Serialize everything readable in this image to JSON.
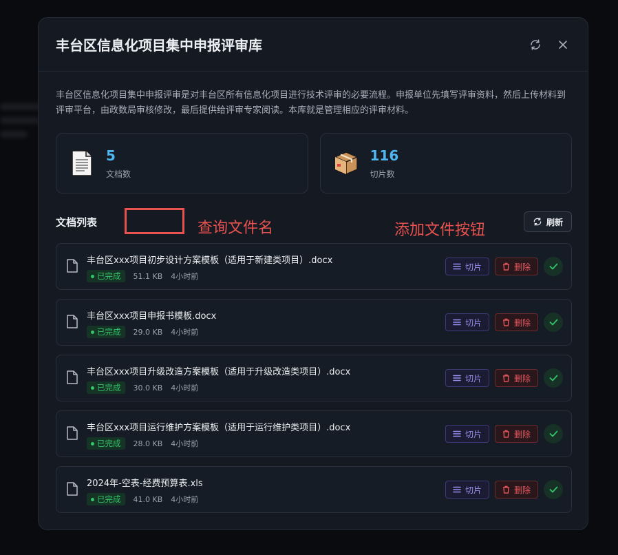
{
  "modal": {
    "title": "丰台区信息化项目集中申报评审库",
    "description": "丰台区信息化项目集中申报评审是对丰台区所有信息化项目进行技术评审的必要流程。申报单位先填写评审资料，然后上传材料到评审平台，由政数局审核修改，最后提供给评审专家阅读。本库就是管理相应的评审材料。"
  },
  "stats": [
    {
      "icon": "document-icon",
      "value": "5",
      "label": "文档数"
    },
    {
      "icon": "package-icon",
      "value": "116",
      "label": "切片数"
    }
  ],
  "list": {
    "title": "文档列表",
    "refresh_label": "刷新"
  },
  "annotations": {
    "search": "查询文件名",
    "add": "添加文件按钮"
  },
  "actions": {
    "slice_label": "切片",
    "delete_label": "删除"
  },
  "files": [
    {
      "name": "丰台区xxx项目初步设计方案模板（适用于新建类项目）.docx",
      "status": "已完成",
      "size": "51.1 KB",
      "time": "4小时前"
    },
    {
      "name": "丰台区xxx项目申报书模板.docx",
      "status": "已完成",
      "size": "29.0 KB",
      "time": "4小时前"
    },
    {
      "name": "丰台区xxx项目升级改造方案模板（适用于升级改造类项目）.docx",
      "status": "已完成",
      "size": "30.0 KB",
      "time": "4小时前"
    },
    {
      "name": "丰台区xxx项目运行维护方案模板（适用于运行维护类项目）.docx",
      "status": "已完成",
      "size": "28.0 KB",
      "time": "4小时前"
    },
    {
      "name": "2024年-空表-经费预算表.xls",
      "status": "已完成",
      "size": "41.0 KB",
      "time": "4小时前"
    }
  ],
  "colors": {
    "accent_blue": "#4fb6f0",
    "success_green": "#34c46a",
    "slice_purple": "#9a8ff0",
    "danger_red": "#e2545c",
    "annotation_red": "#e8524f"
  }
}
